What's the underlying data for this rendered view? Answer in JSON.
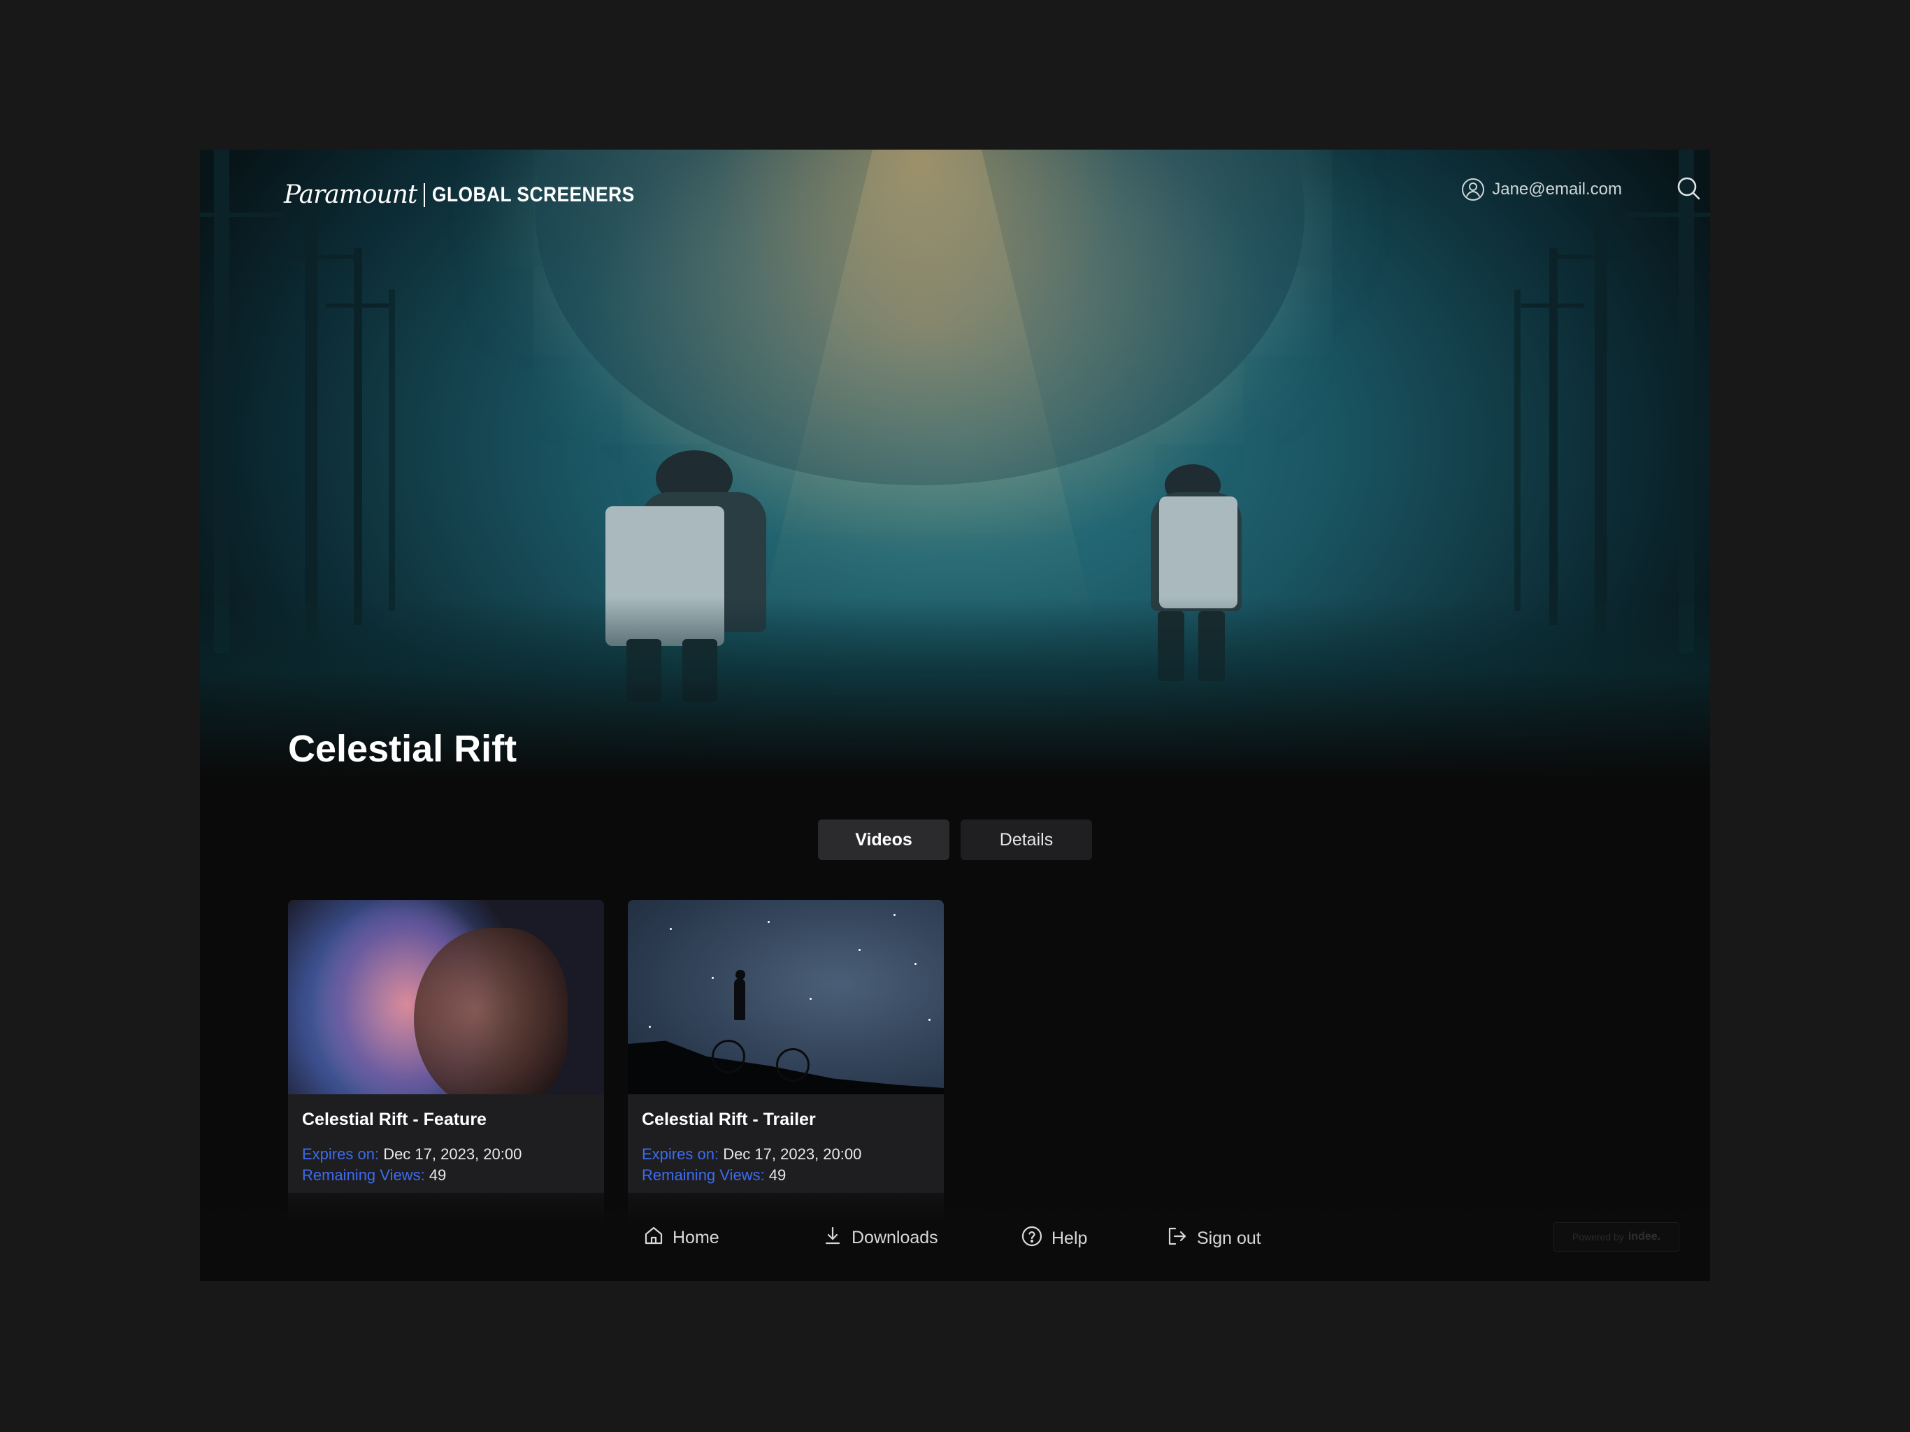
{
  "header": {
    "logo_script": "Paramount",
    "logo_text": "GLOBAL SCREENERS",
    "user_email": "Jane@email.com",
    "user_icon": "user-circle-icon",
    "search_icon": "search-icon"
  },
  "title": "Celestial Rift",
  "tabs": [
    {
      "label": "Videos",
      "active": true
    },
    {
      "label": "Details",
      "active": false
    }
  ],
  "cards": [
    {
      "title": "Celestial Rift - Feature",
      "expires_label": "Expires on:",
      "expires_value": "Dec 17, 2023, 20:00",
      "views_label": "Remaining Views:",
      "views_value": "49"
    },
    {
      "title": "Celestial Rift - Trailer",
      "expires_label": "Expires on:",
      "expires_value": "Dec 17, 2023, 20:00",
      "views_label": "Remaining Views:",
      "views_value": "49"
    }
  ],
  "nav": {
    "home": {
      "label": "Home",
      "icon": "home-icon"
    },
    "downloads": {
      "label": "Downloads",
      "icon": "download-icon"
    },
    "help": {
      "label": "Help",
      "icon": "help-circle-icon"
    },
    "signout": {
      "label": "Sign out",
      "icon": "sign-out-icon"
    }
  },
  "powered_by": {
    "prefix": "Powered by",
    "brand": "indee."
  },
  "colors": {
    "background": "#181818",
    "app": "#0a0a0a",
    "accent_link": "#3d6bf0",
    "card": "#1e1e20"
  }
}
